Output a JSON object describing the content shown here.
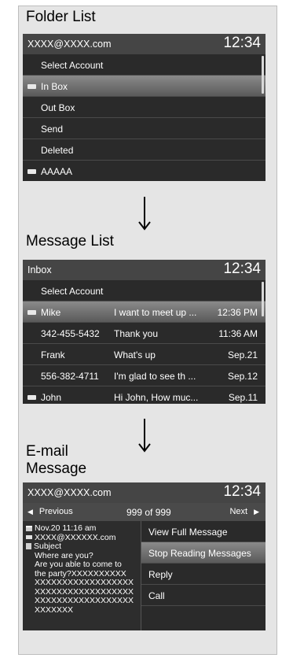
{
  "sections": [
    {
      "label": "Folder List"
    },
    {
      "label": "Message List"
    },
    {
      "label": "E-mail\nMessage"
    }
  ],
  "folder_screen": {
    "header_title": "XXXX@XXXX.com",
    "time": "12:34",
    "items": [
      {
        "label": "Select Account",
        "has_icon": false,
        "selected": false
      },
      {
        "label": "In Box",
        "has_icon": true,
        "selected": true
      },
      {
        "label": "Out Box",
        "has_icon": false,
        "selected": false
      },
      {
        "label": "Send",
        "has_icon": false,
        "selected": false
      },
      {
        "label": "Deleted",
        "has_icon": false,
        "selected": false
      },
      {
        "label": "AAAAA",
        "has_icon": true,
        "selected": false
      }
    ]
  },
  "message_screen": {
    "header_title": "Inbox",
    "time": "12:34",
    "select_account": "Select Account",
    "rows": [
      {
        "sender": "Mike",
        "subject": "I want to meet up ...",
        "time": "12:36 PM",
        "unread": true,
        "selected": true
      },
      {
        "sender": "342-455-5432",
        "subject": "Thank you",
        "time": "11:36 AM",
        "unread": false,
        "selected": false
      },
      {
        "sender": "Frank",
        "subject": "What's up",
        "time": "Sep.21",
        "unread": false,
        "selected": false
      },
      {
        "sender": "556-382-4711",
        "subject": "I'm glad to see th ...",
        "time": "Sep.12",
        "unread": false,
        "selected": false
      },
      {
        "sender": "John",
        "subject": "Hi John, How muc...",
        "time": "Sep.11",
        "unread": true,
        "selected": false
      }
    ]
  },
  "email_screen": {
    "header_title": "XXXX@XXXX.com",
    "time": "12:34",
    "prev": "Previous",
    "count": "999 of 999",
    "next": "Next",
    "message_lines": [
      {
        "text": "Nov.20 11:16 am",
        "icon": "calendar-icon"
      },
      {
        "text": "XXXX@XXXXXX.com",
        "icon": "envelope-icon"
      },
      {
        "text": "Subject",
        "icon": "document-icon"
      },
      {
        "text": "Where are you?",
        "icon": ""
      },
      {
        "text": "Are you able to come to",
        "icon": ""
      },
      {
        "text": "the party?XXXXXXXXXX",
        "icon": ""
      },
      {
        "text": "XXXXXXXXXXXXXXXXXX",
        "icon": ""
      },
      {
        "text": "XXXXXXXXXXXXXXXXXX",
        "icon": ""
      },
      {
        "text": "XXXXXXXXXXXXXXXXXX",
        "icon": ""
      },
      {
        "text": "XXXXXXX",
        "icon": ""
      }
    ],
    "options": [
      {
        "label": "View Full Message",
        "selected": false
      },
      {
        "label": "Stop Reading Messages",
        "selected": true
      },
      {
        "label": "Reply",
        "selected": false
      },
      {
        "label": "Call",
        "selected": false
      }
    ]
  }
}
